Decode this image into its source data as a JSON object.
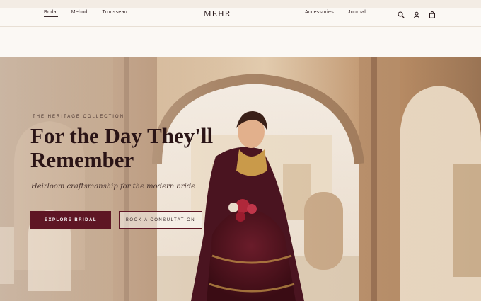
{
  "brand": {
    "name": "MEHR"
  },
  "nav": {
    "left": [
      "Bridal",
      "Mehndi",
      "Trousseau"
    ],
    "right": [
      "Accessories",
      "Journal"
    ],
    "active": "Bridal"
  },
  "icons": [
    "search-icon",
    "account-icon",
    "cart-icon"
  ],
  "hero": {
    "eyebrow": "THE HERITAGE COLLECTION",
    "headline_line1": "For the Day They'll",
    "headline_line2": "Remember",
    "subline": "Heirloom craftsmanship for the modern bride",
    "primary_cta": "EXPLORE BRIDAL",
    "secondary_cta": "BOOK A CONSULTATION"
  },
  "colors": {
    "accent": "#5e1624",
    "background": "#fbf8f4",
    "text": "#2a1a1c"
  }
}
